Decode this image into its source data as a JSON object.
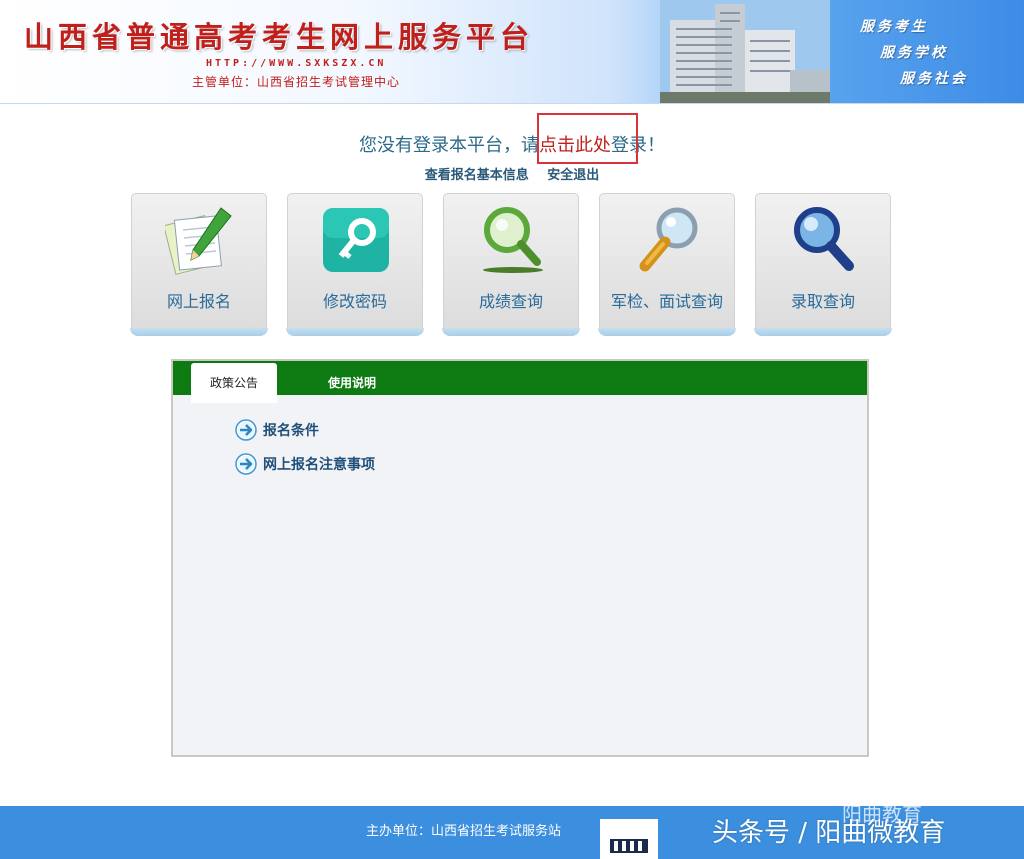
{
  "header": {
    "title": "山西省普通高考考生网上服务平台",
    "url": "HTTP://WWW.SXKSZX.CN",
    "organizer": "主管单位：山西省招生考试管理中心",
    "slogans": [
      "服务考生",
      "服务学校",
      "服务社会"
    ],
    "title_color": "#c0201b"
  },
  "login": {
    "prefix": "您没有登录本平台，请",
    "link": "点击此处",
    "suffix": "登录！"
  },
  "sub_links": {
    "view_info": "查看报名基本信息",
    "logout": "安全退出"
  },
  "tiles": [
    {
      "label": "网上报名",
      "icon": "pencil-paper-icon"
    },
    {
      "label": "修改密码",
      "icon": "key-icon"
    },
    {
      "label": "成绩查询",
      "icon": "green-magnifier-icon"
    },
    {
      "label": "军检、面试查询",
      "icon": "gold-magnifier-icon"
    },
    {
      "label": "录取查询",
      "icon": "blue-magnifier-icon"
    }
  ],
  "tabs": [
    {
      "label": "政策公告",
      "active": true
    },
    {
      "label": "使用说明",
      "active": false
    }
  ],
  "notices": [
    {
      "label": "报名条件"
    },
    {
      "label": "网上报名注意事项"
    }
  ],
  "footer": {
    "sponsor": "主办单位：山西省招生考试服务站",
    "watermark": "头条号 / 阳曲微教育",
    "watermark_faint": "阳曲教育"
  },
  "colors": {
    "tab_bar": "#0d7a12",
    "footer": "#3c8fde",
    "link": "#2b6a8a",
    "highlight": "#d8323a"
  }
}
